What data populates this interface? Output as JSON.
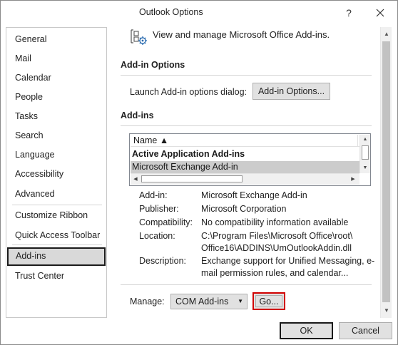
{
  "window": {
    "title": "Outlook Options",
    "help_label": "?",
    "close_label": "✕"
  },
  "sidebar": {
    "items": [
      {
        "label": "General"
      },
      {
        "label": "Mail"
      },
      {
        "label": "Calendar"
      },
      {
        "label": "People"
      },
      {
        "label": "Tasks"
      },
      {
        "label": "Search"
      },
      {
        "label": "Language"
      },
      {
        "label": "Accessibility"
      },
      {
        "label": "Advanced"
      },
      {
        "label": "Customize Ribbon"
      },
      {
        "label": "Quick Access Toolbar"
      },
      {
        "label": "Add-ins",
        "selected": true
      },
      {
        "label": "Trust Center"
      }
    ]
  },
  "main": {
    "header": "View and manage Microsoft Office Add-ins.",
    "addin_options": {
      "title": "Add-in Options",
      "launch_label": "Launch Add-in options dialog:",
      "button_label": "Add-in Options..."
    },
    "addins": {
      "title": "Add-ins",
      "column_name": "Name ▲",
      "group_label": "Active Application Add-ins",
      "selected_row": "Microsoft Exchange Add-in"
    },
    "details": {
      "addin_label": "Add-in:",
      "addin_value": "Microsoft Exchange Add-in",
      "publisher_label": "Publisher:",
      "publisher_value": "Microsoft Corporation",
      "compat_label": "Compatibility:",
      "compat_value": "No compatibility information available",
      "location_label": "Location:",
      "location_line1": "C:\\Program Files\\Microsoft Office\\root\\",
      "location_line2": "Office16\\ADDINS\\UmOutlookAddin.dll",
      "description_label": "Description:",
      "description_line1": "Exchange support for Unified Messaging, e-",
      "description_line2": "mail permission rules, and calendar..."
    },
    "manage": {
      "label": "Manage:",
      "selected": "COM Add-ins",
      "go_label": "Go..."
    }
  },
  "footer": {
    "ok_label": "OK",
    "cancel_label": "Cancel"
  },
  "colors": {
    "go_highlight": "#d00000",
    "selected_row": "#cccccc",
    "button_face": "#e1e1e1"
  }
}
